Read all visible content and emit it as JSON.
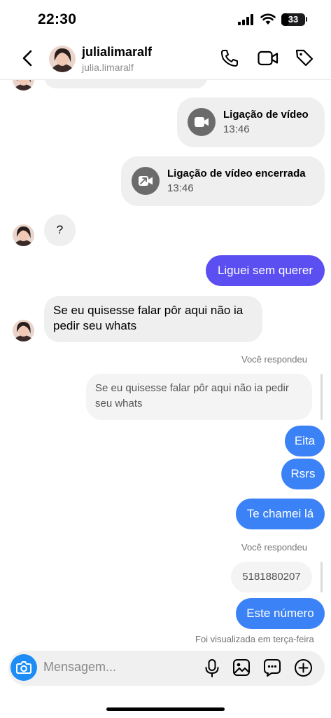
{
  "status_bar": {
    "time": "22:30",
    "battery": "33",
    "battery_fraction": 0.33
  },
  "header": {
    "name": "julialimaralf",
    "username": "julia.limaralf"
  },
  "messages": {
    "call_video": {
      "title": "Ligação de vídeo",
      "time": "13:46"
    },
    "call_ended": {
      "title": "Ligação de vídeo encerrada",
      "time": "13:46"
    },
    "question": "?",
    "liguei": "Liguei sem querer",
    "se_eu_line1": "Se eu quisesse falar pôr aqui não ia",
    "se_eu_line2": "pedir seu whats",
    "replied_label_1": "Você respondeu",
    "reply_quote_line1": "Se eu quisesse falar pôr aqui não ia pedir",
    "reply_quote_line2": "seu whats",
    "eita": "Eita",
    "rsrs": "Rsrs",
    "te_chamei": "Te chamei lá",
    "replied_label_2": "Você respondeu",
    "reply_number": "5181880207",
    "este_numero": "Este número",
    "seen": "Foi visualizada em terça-feira"
  },
  "composer": {
    "placeholder": "Mensagem..."
  },
  "colors": {
    "accent_blue": "#3b82f6",
    "accent_purple": "#5b4ff1",
    "camera_blue": "#1d8cf5"
  },
  "icons": [
    "back-icon",
    "phone-icon",
    "video-camera-icon",
    "tag-icon",
    "camera-icon",
    "microphone-icon",
    "gallery-icon",
    "sticker-icon",
    "plus-icon",
    "signal-icon",
    "wifi-icon",
    "battery-icon"
  ]
}
